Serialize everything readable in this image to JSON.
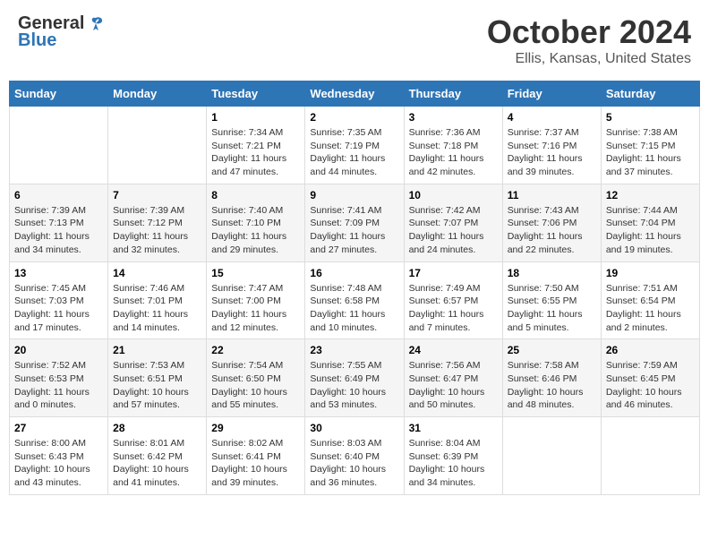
{
  "header": {
    "logo_general": "General",
    "logo_blue": "Blue",
    "month_title": "October 2024",
    "location": "Ellis, Kansas, United States"
  },
  "days_of_week": [
    "Sunday",
    "Monday",
    "Tuesday",
    "Wednesday",
    "Thursday",
    "Friday",
    "Saturday"
  ],
  "weeks": [
    [
      {
        "day": "",
        "sunrise": "",
        "sunset": "",
        "daylight": ""
      },
      {
        "day": "",
        "sunrise": "",
        "sunset": "",
        "daylight": ""
      },
      {
        "day": "1",
        "sunrise": "Sunrise: 7:34 AM",
        "sunset": "Sunset: 7:21 PM",
        "daylight": "Daylight: 11 hours and 47 minutes."
      },
      {
        "day": "2",
        "sunrise": "Sunrise: 7:35 AM",
        "sunset": "Sunset: 7:19 PM",
        "daylight": "Daylight: 11 hours and 44 minutes."
      },
      {
        "day": "3",
        "sunrise": "Sunrise: 7:36 AM",
        "sunset": "Sunset: 7:18 PM",
        "daylight": "Daylight: 11 hours and 42 minutes."
      },
      {
        "day": "4",
        "sunrise": "Sunrise: 7:37 AM",
        "sunset": "Sunset: 7:16 PM",
        "daylight": "Daylight: 11 hours and 39 minutes."
      },
      {
        "day": "5",
        "sunrise": "Sunrise: 7:38 AM",
        "sunset": "Sunset: 7:15 PM",
        "daylight": "Daylight: 11 hours and 37 minutes."
      }
    ],
    [
      {
        "day": "6",
        "sunrise": "Sunrise: 7:39 AM",
        "sunset": "Sunset: 7:13 PM",
        "daylight": "Daylight: 11 hours and 34 minutes."
      },
      {
        "day": "7",
        "sunrise": "Sunrise: 7:39 AM",
        "sunset": "Sunset: 7:12 PM",
        "daylight": "Daylight: 11 hours and 32 minutes."
      },
      {
        "day": "8",
        "sunrise": "Sunrise: 7:40 AM",
        "sunset": "Sunset: 7:10 PM",
        "daylight": "Daylight: 11 hours and 29 minutes."
      },
      {
        "day": "9",
        "sunrise": "Sunrise: 7:41 AM",
        "sunset": "Sunset: 7:09 PM",
        "daylight": "Daylight: 11 hours and 27 minutes."
      },
      {
        "day": "10",
        "sunrise": "Sunrise: 7:42 AM",
        "sunset": "Sunset: 7:07 PM",
        "daylight": "Daylight: 11 hours and 24 minutes."
      },
      {
        "day": "11",
        "sunrise": "Sunrise: 7:43 AM",
        "sunset": "Sunset: 7:06 PM",
        "daylight": "Daylight: 11 hours and 22 minutes."
      },
      {
        "day": "12",
        "sunrise": "Sunrise: 7:44 AM",
        "sunset": "Sunset: 7:04 PM",
        "daylight": "Daylight: 11 hours and 19 minutes."
      }
    ],
    [
      {
        "day": "13",
        "sunrise": "Sunrise: 7:45 AM",
        "sunset": "Sunset: 7:03 PM",
        "daylight": "Daylight: 11 hours and 17 minutes."
      },
      {
        "day": "14",
        "sunrise": "Sunrise: 7:46 AM",
        "sunset": "Sunset: 7:01 PM",
        "daylight": "Daylight: 11 hours and 14 minutes."
      },
      {
        "day": "15",
        "sunrise": "Sunrise: 7:47 AM",
        "sunset": "Sunset: 7:00 PM",
        "daylight": "Daylight: 11 hours and 12 minutes."
      },
      {
        "day": "16",
        "sunrise": "Sunrise: 7:48 AM",
        "sunset": "Sunset: 6:58 PM",
        "daylight": "Daylight: 11 hours and 10 minutes."
      },
      {
        "day": "17",
        "sunrise": "Sunrise: 7:49 AM",
        "sunset": "Sunset: 6:57 PM",
        "daylight": "Daylight: 11 hours and 7 minutes."
      },
      {
        "day": "18",
        "sunrise": "Sunrise: 7:50 AM",
        "sunset": "Sunset: 6:55 PM",
        "daylight": "Daylight: 11 hours and 5 minutes."
      },
      {
        "day": "19",
        "sunrise": "Sunrise: 7:51 AM",
        "sunset": "Sunset: 6:54 PM",
        "daylight": "Daylight: 11 hours and 2 minutes."
      }
    ],
    [
      {
        "day": "20",
        "sunrise": "Sunrise: 7:52 AM",
        "sunset": "Sunset: 6:53 PM",
        "daylight": "Daylight: 11 hours and 0 minutes."
      },
      {
        "day": "21",
        "sunrise": "Sunrise: 7:53 AM",
        "sunset": "Sunset: 6:51 PM",
        "daylight": "Daylight: 10 hours and 57 minutes."
      },
      {
        "day": "22",
        "sunrise": "Sunrise: 7:54 AM",
        "sunset": "Sunset: 6:50 PM",
        "daylight": "Daylight: 10 hours and 55 minutes."
      },
      {
        "day": "23",
        "sunrise": "Sunrise: 7:55 AM",
        "sunset": "Sunset: 6:49 PM",
        "daylight": "Daylight: 10 hours and 53 minutes."
      },
      {
        "day": "24",
        "sunrise": "Sunrise: 7:56 AM",
        "sunset": "Sunset: 6:47 PM",
        "daylight": "Daylight: 10 hours and 50 minutes."
      },
      {
        "day": "25",
        "sunrise": "Sunrise: 7:58 AM",
        "sunset": "Sunset: 6:46 PM",
        "daylight": "Daylight: 10 hours and 48 minutes."
      },
      {
        "day": "26",
        "sunrise": "Sunrise: 7:59 AM",
        "sunset": "Sunset: 6:45 PM",
        "daylight": "Daylight: 10 hours and 46 minutes."
      }
    ],
    [
      {
        "day": "27",
        "sunrise": "Sunrise: 8:00 AM",
        "sunset": "Sunset: 6:43 PM",
        "daylight": "Daylight: 10 hours and 43 minutes."
      },
      {
        "day": "28",
        "sunrise": "Sunrise: 8:01 AM",
        "sunset": "Sunset: 6:42 PM",
        "daylight": "Daylight: 10 hours and 41 minutes."
      },
      {
        "day": "29",
        "sunrise": "Sunrise: 8:02 AM",
        "sunset": "Sunset: 6:41 PM",
        "daylight": "Daylight: 10 hours and 39 minutes."
      },
      {
        "day": "30",
        "sunrise": "Sunrise: 8:03 AM",
        "sunset": "Sunset: 6:40 PM",
        "daylight": "Daylight: 10 hours and 36 minutes."
      },
      {
        "day": "31",
        "sunrise": "Sunrise: 8:04 AM",
        "sunset": "Sunset: 6:39 PM",
        "daylight": "Daylight: 10 hours and 34 minutes."
      },
      {
        "day": "",
        "sunrise": "",
        "sunset": "",
        "daylight": ""
      },
      {
        "day": "",
        "sunrise": "",
        "sunset": "",
        "daylight": ""
      }
    ]
  ]
}
